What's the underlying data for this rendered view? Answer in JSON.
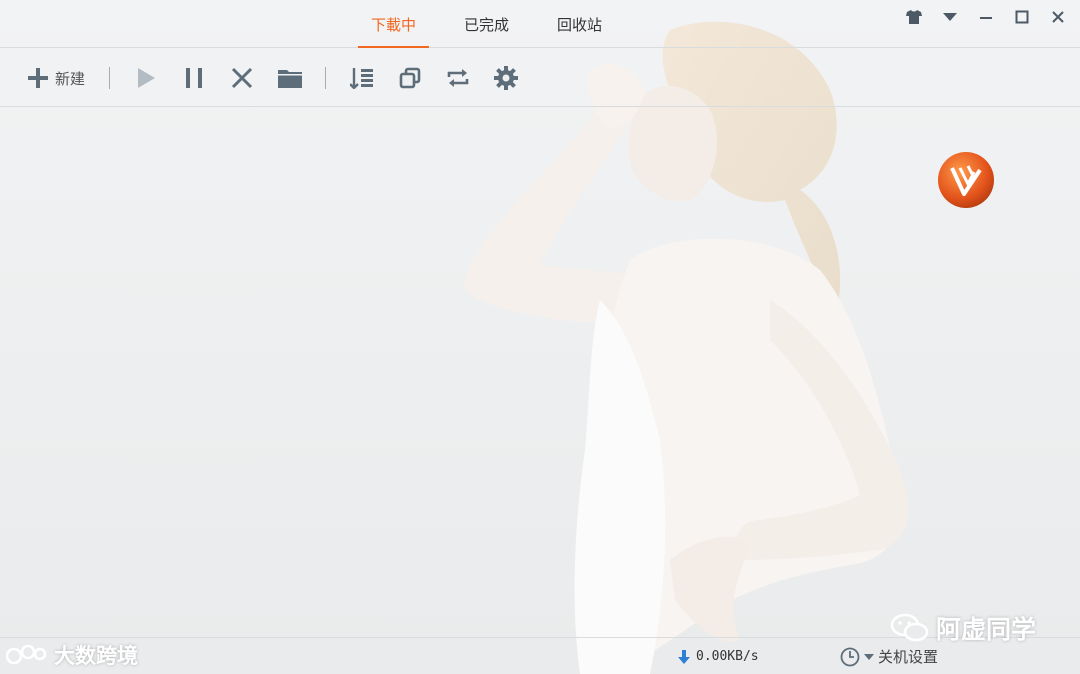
{
  "tabs": [
    {
      "label": "下載中",
      "active": true
    },
    {
      "label": "已完成",
      "active": false
    },
    {
      "label": "回收站",
      "active": false
    }
  ],
  "window_controls": [
    "skin-icon",
    "menu-dropdown-icon",
    "minimize-icon",
    "maximize-icon",
    "close-icon"
  ],
  "toolbar": {
    "new_label": "新建",
    "buttons": [
      "new-icon",
      "start-icon",
      "pause-icon",
      "delete-icon",
      "open-folder-icon",
      "sort-icon",
      "copy-icon",
      "refresh-icon",
      "settings-icon"
    ]
  },
  "status": {
    "speed": "0.00KB/s",
    "shutdown_label": "关机设置"
  },
  "watermarks": {
    "left": "大数跨境",
    "right": "阿虚同学"
  },
  "colors": {
    "accent": "#f26722",
    "icon": "#5d6d7a",
    "icon_disabled": "#b4bcc3",
    "download_arrow": "#2e7fd6",
    "background": "#eef0f1"
  }
}
